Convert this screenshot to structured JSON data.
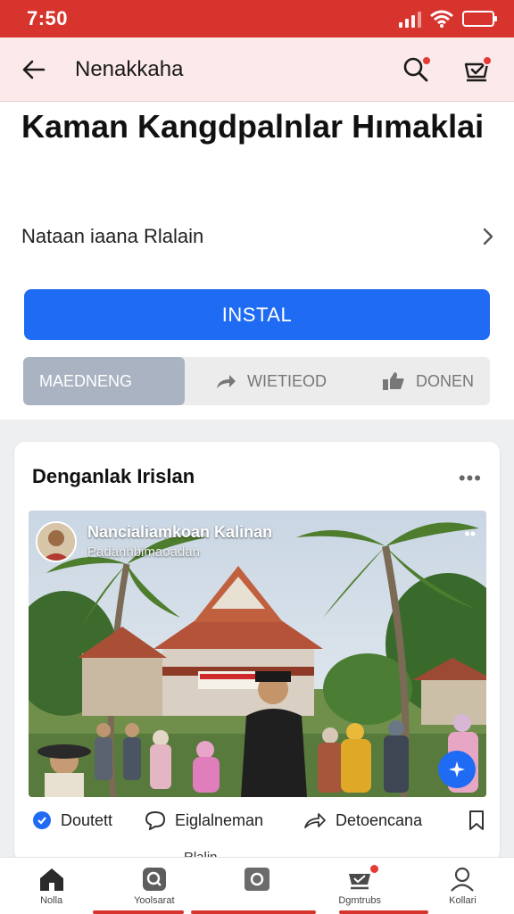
{
  "status_bar": {
    "time": "7:50"
  },
  "app_bar": {
    "title": "Nenakkaha"
  },
  "header": {
    "headline": "Kaman Kangdpalnlar Hımaklai",
    "subline": "Nataan iaana Rlalain"
  },
  "install_button": {
    "label": "INSTAL"
  },
  "segments": [
    {
      "label": "MAEDNENG"
    },
    {
      "label": "WIETIEOD"
    },
    {
      "label": "DONEN"
    }
  ],
  "card": {
    "title": "Denganlak Irislan",
    "more": "•••",
    "post": {
      "author": "Nancialiamkoan Kalinan",
      "subtitle": "Padanhbimaoadan",
      "overflow": "••"
    },
    "actions": [
      {
        "label": "Doutett"
      },
      {
        "label": "Eiglalneman"
      },
      {
        "label": "Detoencana"
      }
    ]
  },
  "peek_text": "Rlalin ......",
  "bottom_nav": [
    {
      "label": "Nolla"
    },
    {
      "label": "Yoolsarat"
    },
    {
      "label": ""
    },
    {
      "label": "Dgmtrubs"
    },
    {
      "label": "Kollari"
    }
  ],
  "colors": {
    "brand_red": "#d7342e",
    "accent_blue": "#1f6bf3",
    "app_bar_bg": "#fce9e9"
  }
}
